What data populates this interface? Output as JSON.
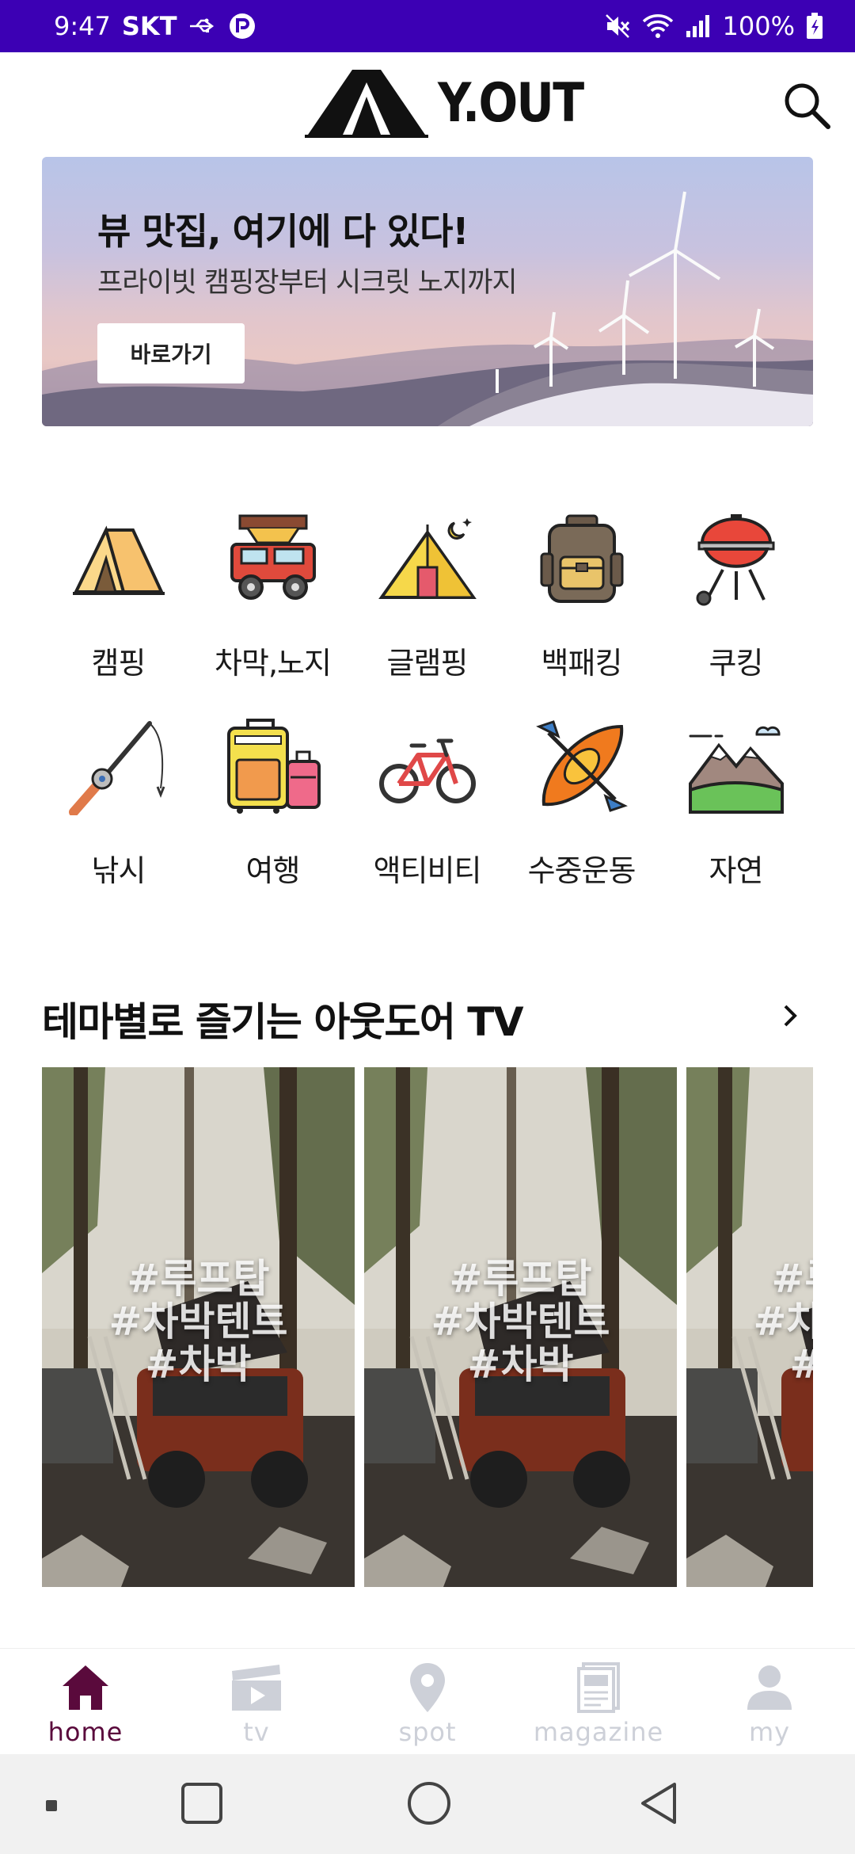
{
  "status_bar": {
    "time": "9:47",
    "carrier": "SKT",
    "battery": "100%",
    "icons": [
      "usb-icon",
      "app-notification-icon",
      "mute-icon",
      "wifi-icon",
      "signal-icon",
      "battery-icon"
    ]
  },
  "header": {
    "logo_text": "Y.OUT",
    "icons": [
      "tent-logo-icon",
      "search-icon"
    ]
  },
  "banner": {
    "title": "뷰 맛집, 여기에 다 있다!",
    "subtitle": "프라이빗 캠핑장부터 시크릿 노지까지",
    "button_label": "바로가기"
  },
  "categories": [
    {
      "label": "캠핑",
      "icon": "tent-icon"
    },
    {
      "label": "차막,노지",
      "icon": "jeep-icon"
    },
    {
      "label": "글램핑",
      "icon": "glamping-tent-icon"
    },
    {
      "label": "백패킹",
      "icon": "backpack-icon"
    },
    {
      "label": "쿠킹",
      "icon": "grill-icon"
    },
    {
      "label": "낚시",
      "icon": "fishing-rod-icon"
    },
    {
      "label": "여행",
      "icon": "luggage-icon"
    },
    {
      "label": "액티비티",
      "icon": "bicycle-icon"
    },
    {
      "label": "수중운동",
      "icon": "kayak-icon"
    },
    {
      "label": "자연",
      "icon": "mountain-icon"
    }
  ],
  "tv_section": {
    "title": "테마별로 즐기는 아웃도어 TV",
    "cards": [
      {
        "tags": [
          "#루프탑",
          "#차박텐트",
          "#차박"
        ]
      },
      {
        "tags": [
          "#루프탑",
          "#차박텐트",
          "#차박"
        ]
      },
      {
        "tags": [
          "#루프탑",
          "#차박텐트",
          "#차박"
        ]
      }
    ]
  },
  "bottom_nav": [
    {
      "label": "home",
      "icon": "home-icon",
      "active": true
    },
    {
      "label": "tv",
      "icon": "clapperboard-icon",
      "active": false
    },
    {
      "label": "spot",
      "icon": "location-pin-icon",
      "active": false
    },
    {
      "label": "magazine",
      "icon": "magazine-icon",
      "active": false
    },
    {
      "label": "my",
      "icon": "person-icon",
      "active": false
    }
  ],
  "colors": {
    "status_bar": "#3c00b4",
    "active_nav": "#5a0a3c",
    "inactive_nav": "#cdd0d8"
  }
}
